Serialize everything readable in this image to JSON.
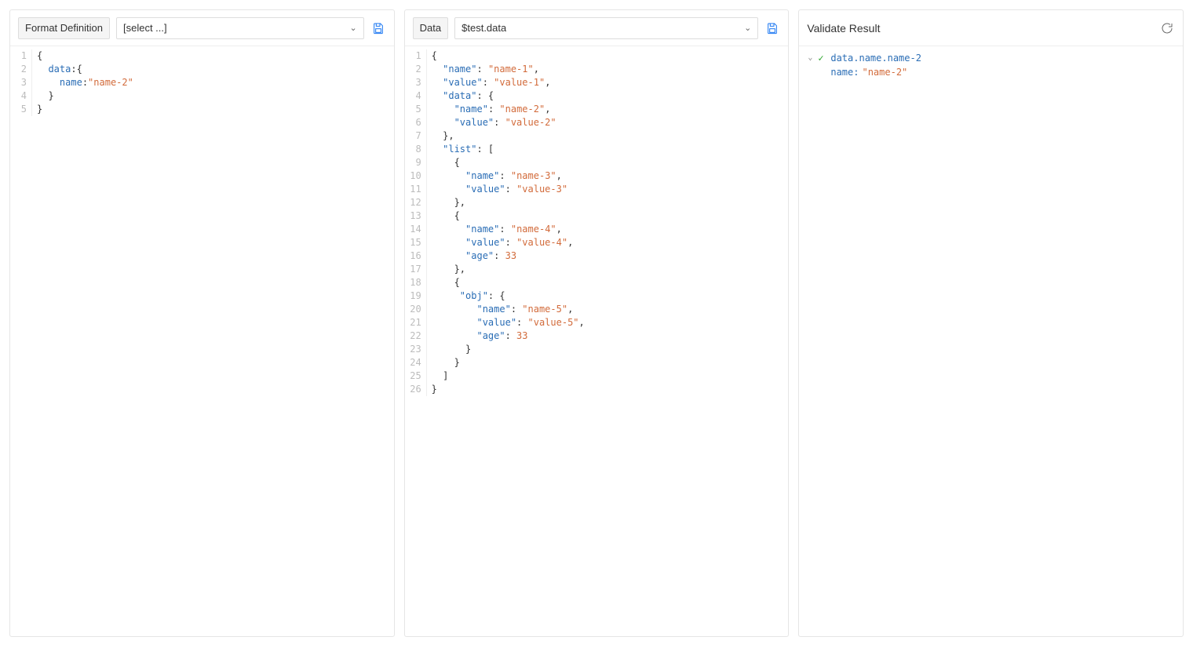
{
  "panels": {
    "format": {
      "label": "Format Definition",
      "select_placeholder": "[select ...]",
      "code": [
        [
          {
            "t": "punct",
            "v": "{"
          }
        ],
        [
          {
            "t": "pad",
            "v": "  "
          },
          {
            "t": "key",
            "v": "data"
          },
          {
            "t": "punct",
            "v": ":{"
          }
        ],
        [
          {
            "t": "pad",
            "v": "    "
          },
          {
            "t": "key",
            "v": "name"
          },
          {
            "t": "punct",
            "v": ":"
          },
          {
            "t": "str",
            "v": "\"name-2\""
          }
        ],
        [
          {
            "t": "pad",
            "v": "  "
          },
          {
            "t": "punct",
            "v": "}"
          }
        ],
        [
          {
            "t": "punct",
            "v": "}"
          }
        ]
      ]
    },
    "data": {
      "label": "Data",
      "select_value": "$test.data",
      "code": [
        [
          {
            "t": "punct",
            "v": "{"
          }
        ],
        [
          {
            "t": "pad",
            "v": "  "
          },
          {
            "t": "key",
            "v": "\"name\""
          },
          {
            "t": "punct",
            "v": ": "
          },
          {
            "t": "str",
            "v": "\"name-1\""
          },
          {
            "t": "punct",
            "v": ","
          }
        ],
        [
          {
            "t": "pad",
            "v": "  "
          },
          {
            "t": "key",
            "v": "\"value\""
          },
          {
            "t": "punct",
            "v": ": "
          },
          {
            "t": "str",
            "v": "\"value-1\""
          },
          {
            "t": "punct",
            "v": ","
          }
        ],
        [
          {
            "t": "pad",
            "v": "  "
          },
          {
            "t": "key",
            "v": "\"data\""
          },
          {
            "t": "punct",
            "v": ": {"
          }
        ],
        [
          {
            "t": "pad",
            "v": "    "
          },
          {
            "t": "key",
            "v": "\"name\""
          },
          {
            "t": "punct",
            "v": ": "
          },
          {
            "t": "str",
            "v": "\"name-2\""
          },
          {
            "t": "punct",
            "v": ","
          }
        ],
        [
          {
            "t": "pad",
            "v": "    "
          },
          {
            "t": "key",
            "v": "\"value\""
          },
          {
            "t": "punct",
            "v": ": "
          },
          {
            "t": "str",
            "v": "\"value-2\""
          }
        ],
        [
          {
            "t": "pad",
            "v": "  "
          },
          {
            "t": "punct",
            "v": "},"
          }
        ],
        [
          {
            "t": "pad",
            "v": "  "
          },
          {
            "t": "key",
            "v": "\"list\""
          },
          {
            "t": "punct",
            "v": ": ["
          }
        ],
        [
          {
            "t": "pad",
            "v": "    "
          },
          {
            "t": "punct",
            "v": "{"
          }
        ],
        [
          {
            "t": "pad",
            "v": "      "
          },
          {
            "t": "key",
            "v": "\"name\""
          },
          {
            "t": "punct",
            "v": ": "
          },
          {
            "t": "str",
            "v": "\"name-3\""
          },
          {
            "t": "punct",
            "v": ","
          }
        ],
        [
          {
            "t": "pad",
            "v": "      "
          },
          {
            "t": "key",
            "v": "\"value\""
          },
          {
            "t": "punct",
            "v": ": "
          },
          {
            "t": "str",
            "v": "\"value-3\""
          }
        ],
        [
          {
            "t": "pad",
            "v": "    "
          },
          {
            "t": "punct",
            "v": "},"
          }
        ],
        [
          {
            "t": "pad",
            "v": "    "
          },
          {
            "t": "punct",
            "v": "{"
          }
        ],
        [
          {
            "t": "pad",
            "v": "      "
          },
          {
            "t": "key",
            "v": "\"name\""
          },
          {
            "t": "punct",
            "v": ": "
          },
          {
            "t": "str",
            "v": "\"name-4\""
          },
          {
            "t": "punct",
            "v": ","
          }
        ],
        [
          {
            "t": "pad",
            "v": "      "
          },
          {
            "t": "key",
            "v": "\"value\""
          },
          {
            "t": "punct",
            "v": ": "
          },
          {
            "t": "str",
            "v": "\"value-4\""
          },
          {
            "t": "punct",
            "v": ","
          }
        ],
        [
          {
            "t": "pad",
            "v": "      "
          },
          {
            "t": "key",
            "v": "\"age\""
          },
          {
            "t": "punct",
            "v": ": "
          },
          {
            "t": "num",
            "v": "33"
          }
        ],
        [
          {
            "t": "pad",
            "v": "    "
          },
          {
            "t": "punct",
            "v": "},"
          }
        ],
        [
          {
            "t": "pad",
            "v": "    "
          },
          {
            "t": "punct",
            "v": "{"
          }
        ],
        [
          {
            "t": "pad",
            "v": "     "
          },
          {
            "t": "key",
            "v": "\"obj\""
          },
          {
            "t": "punct",
            "v": ": {"
          }
        ],
        [
          {
            "t": "pad",
            "v": "        "
          },
          {
            "t": "key",
            "v": "\"name\""
          },
          {
            "t": "punct",
            "v": ": "
          },
          {
            "t": "str",
            "v": "\"name-5\""
          },
          {
            "t": "punct",
            "v": ","
          }
        ],
        [
          {
            "t": "pad",
            "v": "        "
          },
          {
            "t": "key",
            "v": "\"value\""
          },
          {
            "t": "punct",
            "v": ": "
          },
          {
            "t": "str",
            "v": "\"value-5\""
          },
          {
            "t": "punct",
            "v": ","
          }
        ],
        [
          {
            "t": "pad",
            "v": "        "
          },
          {
            "t": "key",
            "v": "\"age\""
          },
          {
            "t": "punct",
            "v": ": "
          },
          {
            "t": "num",
            "v": "33"
          }
        ],
        [
          {
            "t": "pad",
            "v": "      "
          },
          {
            "t": "punct",
            "v": "}"
          }
        ],
        [
          {
            "t": "pad",
            "v": "    "
          },
          {
            "t": "punct",
            "v": "}"
          }
        ],
        [
          {
            "t": "pad",
            "v": "  "
          },
          {
            "t": "punct",
            "v": "]"
          }
        ],
        [
          {
            "t": "punct",
            "v": "}"
          }
        ]
      ]
    },
    "result": {
      "title": "Validate Result",
      "items": [
        {
          "path": "data.name.name-2",
          "detail_key": "name",
          "detail_value": "\"name-2\""
        }
      ]
    }
  }
}
